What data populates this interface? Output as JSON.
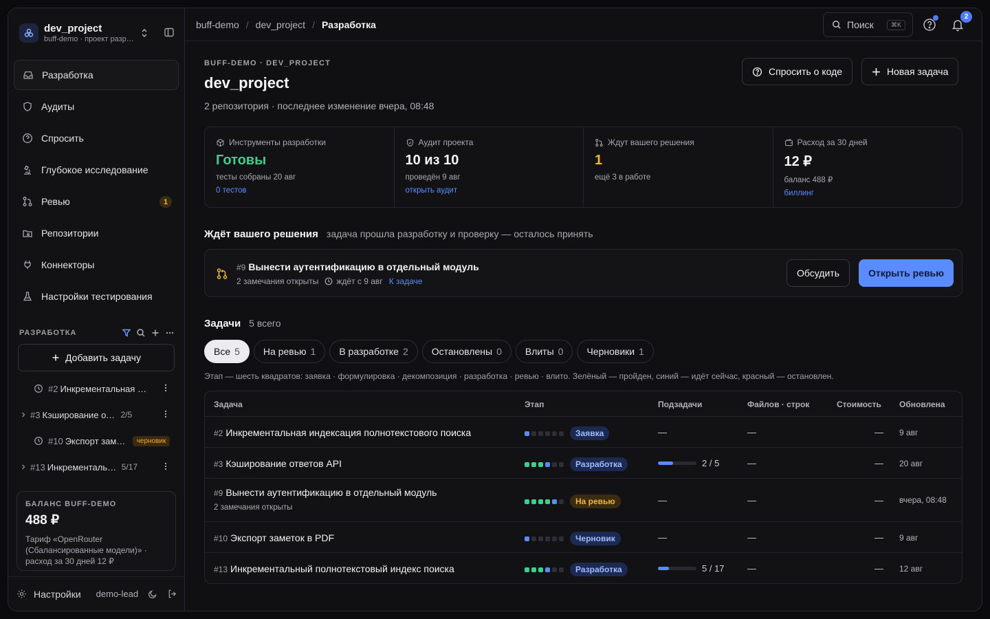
{
  "sidebar": {
    "workspace": {
      "name": "dev_project",
      "sub": "buff-demo · проект разработки"
    },
    "nav": [
      {
        "label": "Разработка",
        "icon": "inbox-icon",
        "active": true
      },
      {
        "label": "Аудиты",
        "icon": "shield-icon"
      },
      {
        "label": "Спросить",
        "icon": "question-circle-icon"
      },
      {
        "label": "Глубокое исследование",
        "icon": "microscope-icon"
      },
      {
        "label": "Ревью",
        "icon": "git-pull-icon",
        "badge": "1"
      },
      {
        "label": "Репозитории",
        "icon": "folder-git-icon"
      },
      {
        "label": "Коннекторы",
        "icon": "plug-icon"
      },
      {
        "label": "Настройки тестирования",
        "icon": "flask-icon"
      }
    ],
    "section_title": "РАЗРАБОТКА",
    "add_task": "Добавить задачу",
    "tasks": [
      {
        "num": "#2",
        "title": "Инкрементальная индексация полнотекстового поиска",
        "expandable": false
      },
      {
        "num": "#3",
        "title": "Кэширование ответов API",
        "count": "2/5",
        "expandable": true
      },
      {
        "num": "#10",
        "title": "Экспорт заметок в PDF",
        "badge": "черновик",
        "expandable": false
      },
      {
        "num": "#13",
        "title": "Инкрементальный полнотекстовый индекс поиска",
        "count": "5/17",
        "expandable": true
      }
    ],
    "balance": {
      "title": "БАЛАНС BUFF-DEMO",
      "amount": "488 ₽",
      "desc": "Тариф «OpenRouter (Сбалансированные модели)» · расход за 30 дней 12 ₽"
    },
    "footer": {
      "settings": "Настройки",
      "user": "demo-lead"
    }
  },
  "topbar": {
    "breadcrumb": [
      "buff-demo",
      "dev_project",
      "Разработка"
    ],
    "search": "Поиск",
    "search_kbd": "⌘K",
    "notif_count": "2"
  },
  "header": {
    "crumb": "BUFF-DEMO · DEV_PROJECT",
    "title": "dev_project",
    "subtitle": "2 репозитория · последнее изменение вчера, 08:48",
    "ask_button": "Спросить о коде",
    "new_button": "Новая задача"
  },
  "stats": [
    {
      "label": "Инструменты разработки",
      "icon": "cube-icon",
      "value": "Готовы",
      "value_color": "#3ecf8e",
      "desc": "тесты собраны 20 авг",
      "link": "0 тестов"
    },
    {
      "label": "Аудит проекта",
      "icon": "shield-check-icon",
      "value": "10 из 10",
      "value_color": "#f4f4f6",
      "desc": "проведён 9 авг",
      "link": "открыть аудит"
    },
    {
      "label": "Ждут вашего решения",
      "icon": "git-pull-icon",
      "value": "1",
      "value_color": "#f5b33d",
      "desc": "ещё 3 в работе",
      "link": ""
    },
    {
      "label": "Расход за 30 дней",
      "icon": "wallet-icon",
      "value": "12 ₽",
      "value_color": "#f4f4f6",
      "desc": "баланс 488 ₽",
      "link": "биллинг"
    }
  ],
  "pending": {
    "title": "Ждёт вашего решения",
    "subtitle": "задача прошла разработку и проверку — осталось принять",
    "num": "#9",
    "task": "Вынести аутентификацию в отдельный модуль",
    "remarks": "2 замечания открыты",
    "waiting": "ждёт с 9 авг",
    "link": "К задаче",
    "discuss": "Обсудить",
    "open": "Открыть ревью"
  },
  "tasks": {
    "title": "Задачи",
    "total": "5 всего",
    "filters": [
      {
        "label": "Все",
        "count": "5",
        "active": true
      },
      {
        "label": "На ревью",
        "count": "1"
      },
      {
        "label": "В разработке",
        "count": "2"
      },
      {
        "label": "Остановлены",
        "count": "0"
      },
      {
        "label": "Влиты",
        "count": "0"
      },
      {
        "label": "Черновики",
        "count": "1"
      }
    ],
    "legend": "Этап — шесть квадратов: заявка · формулировка · декомпозиция · разработка · ревью · влито. Зелёный — пройден, синий — идёт сейчас, красный — остановлен.",
    "columns": [
      "Задача",
      "Этап",
      "Подзадачи",
      "Файлов · строк",
      "Стоимость",
      "Обновлена"
    ],
    "rows": [
      {
        "num": "#2",
        "title": "Инкрементальная индексация полнотекстового поиска",
        "sub": "",
        "stage": [
          "b",
          "n",
          "n",
          "n",
          "n",
          "n"
        ],
        "stage_label": "Заявка",
        "pill": "blue",
        "subtasks": "—",
        "progress": null,
        "files": "—",
        "cost": "—",
        "updated": "9 авг"
      },
      {
        "num": "#3",
        "title": "Кэширование ответов API",
        "sub": "",
        "stage": [
          "g",
          "g",
          "g",
          "b",
          "n",
          "n"
        ],
        "stage_label": "Разработка",
        "pill": "blue",
        "subtasks": "2 / 5",
        "progress": 0.4,
        "files": "—",
        "cost": "—",
        "updated": "20 авг"
      },
      {
        "num": "#9",
        "title": "Вынести аутентификацию в отдельный модуль",
        "sub": "2 замечания открыты",
        "stage": [
          "g",
          "g",
          "g",
          "g",
          "b",
          "n"
        ],
        "stage_label": "На ревью",
        "pill": "yel",
        "subtasks": "—",
        "progress": null,
        "files": "—",
        "cost": "—",
        "updated": "вчера, 08:48"
      },
      {
        "num": "#10",
        "title": "Экспорт заметок в PDF",
        "sub": "",
        "stage": [
          "b",
          "n",
          "n",
          "n",
          "n",
          "n"
        ],
        "stage_label": "Черновик",
        "pill": "blue",
        "subtasks": "—",
        "progress": null,
        "files": "—",
        "cost": "—",
        "updated": "9 авг"
      },
      {
        "num": "#13",
        "title": "Инкрементальный полнотекстовый индекс поиска",
        "sub": "",
        "stage": [
          "g",
          "g",
          "g",
          "b",
          "n",
          "n"
        ],
        "stage_label": "Разработка",
        "pill": "blue",
        "subtasks": "5 / 17",
        "progress": 0.29,
        "files": "—",
        "cost": "—",
        "updated": "12 авг"
      }
    ]
  }
}
